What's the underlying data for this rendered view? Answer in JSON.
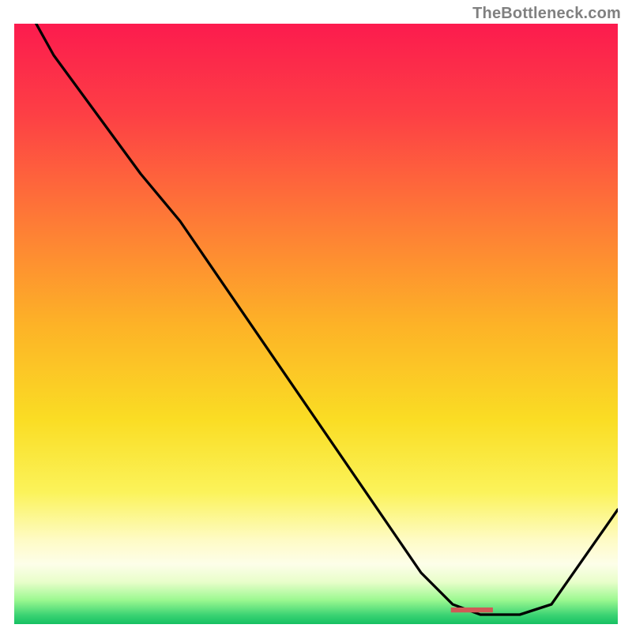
{
  "attribution": "TheBottleneck.com",
  "highlight_label": "■■■■■■■■■",
  "chart_data": {
    "type": "line",
    "title": "",
    "xlabel": "",
    "ylabel": "",
    "xlim": [
      0,
      100
    ],
    "ylim": [
      0,
      100
    ],
    "x": [
      0,
      5,
      10,
      15,
      20,
      25,
      30,
      35,
      40,
      45,
      50,
      55,
      60,
      65,
      70,
      75,
      80,
      85,
      90,
      95,
      100
    ],
    "values": [
      107,
      100,
      93,
      86,
      79,
      71,
      61,
      53,
      45,
      37,
      30,
      22,
      14,
      8,
      3,
      0,
      0,
      0,
      4,
      10,
      18
    ],
    "highlight_range_x": [
      73,
      86
    ],
    "annotations": [
      {
        "text": "TheBottleneck.com",
        "position": "top-right"
      }
    ]
  }
}
